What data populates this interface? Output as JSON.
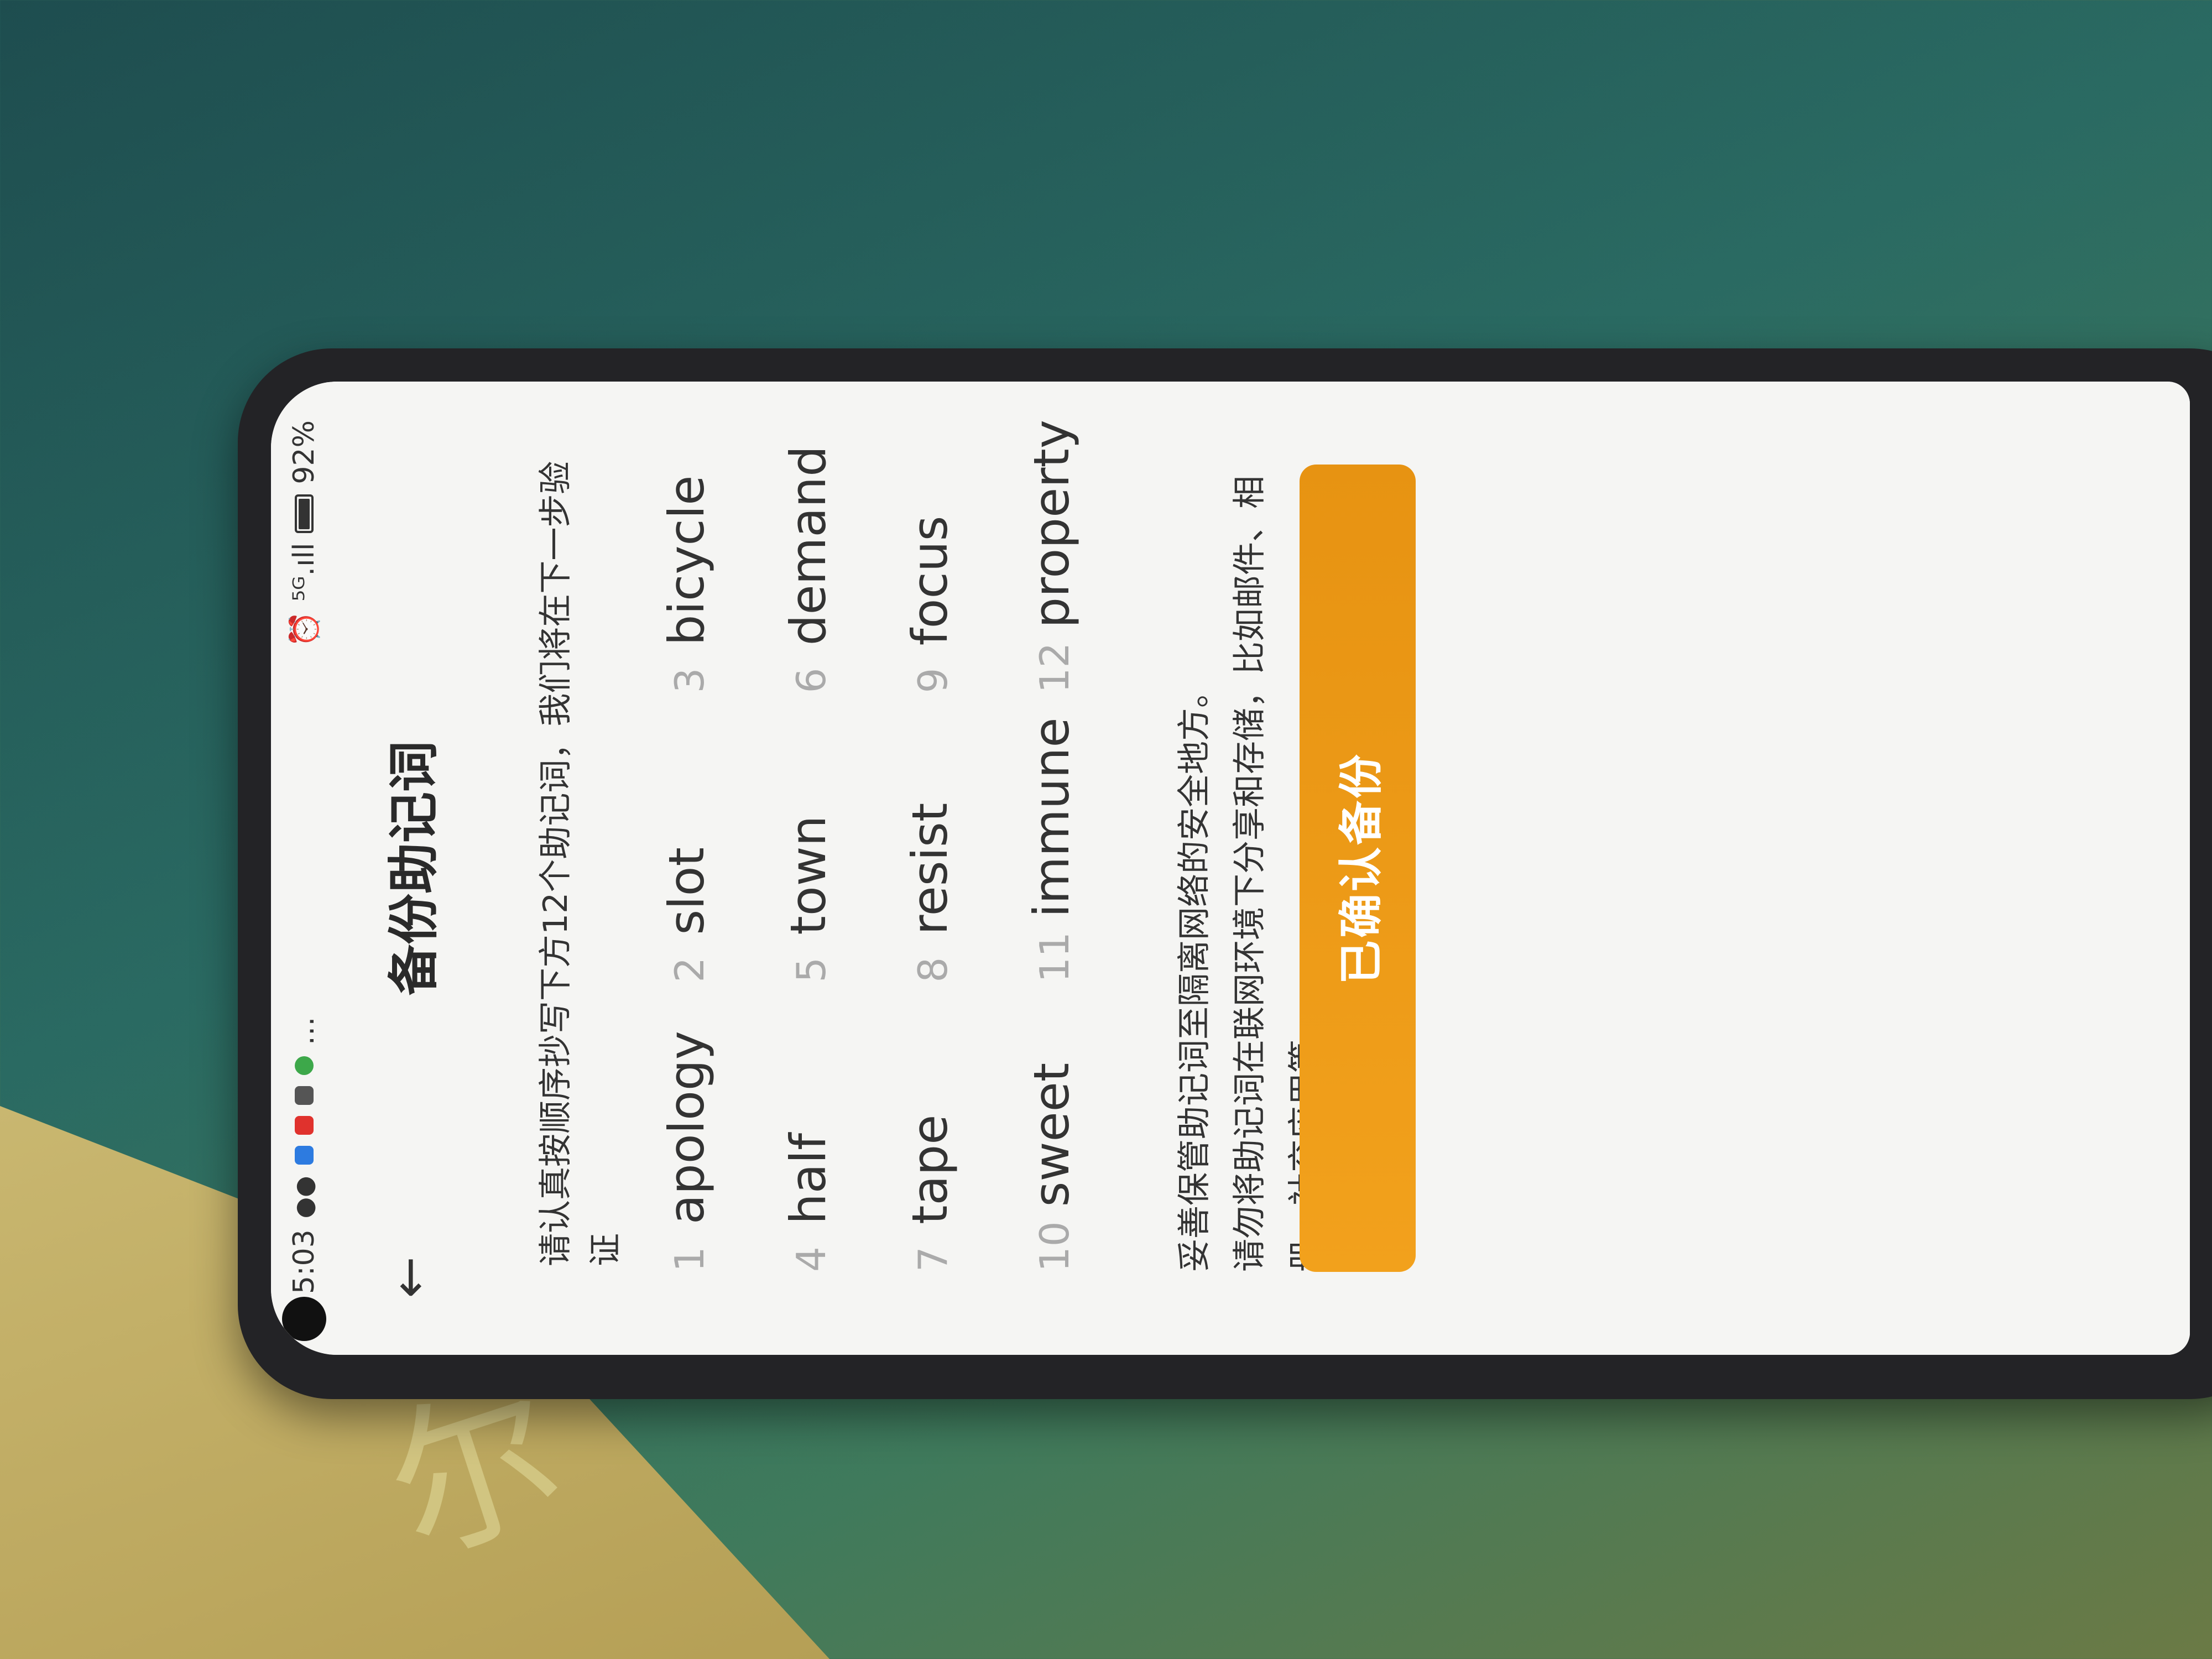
{
  "status": {
    "time": "5:03",
    "right_text": "⁵ᴳ.ıll",
    "battery": "92%"
  },
  "header": {
    "back": "←",
    "title": "备份助记词"
  },
  "instruction": "请认真按顺序抄写下方12个助记词，我们将在下一步验证",
  "words": [
    {
      "n": "1",
      "w": "apology"
    },
    {
      "n": "2",
      "w": "slot"
    },
    {
      "n": "3",
      "w": "bicycle"
    },
    {
      "n": "4",
      "w": "half"
    },
    {
      "n": "5",
      "w": "town"
    },
    {
      "n": "6",
      "w": "demand"
    },
    {
      "n": "7",
      "w": "tape"
    },
    {
      "n": "8",
      "w": "resist"
    },
    {
      "n": "9",
      "w": "focus"
    },
    {
      "n": "10",
      "w": "sweet"
    },
    {
      "n": "11",
      "w": "immune"
    },
    {
      "n": "12",
      "w": "property"
    }
  ],
  "warning_line1": "妥善保管助记词至隔离网络的安全地方。",
  "warning_line2": "请勿将助记词在联网环境下分享和存储，比如邮件、相册、社交应用等。",
  "confirm_button": "已确认备份",
  "colors": {
    "accent": "#f2a11c"
  }
}
